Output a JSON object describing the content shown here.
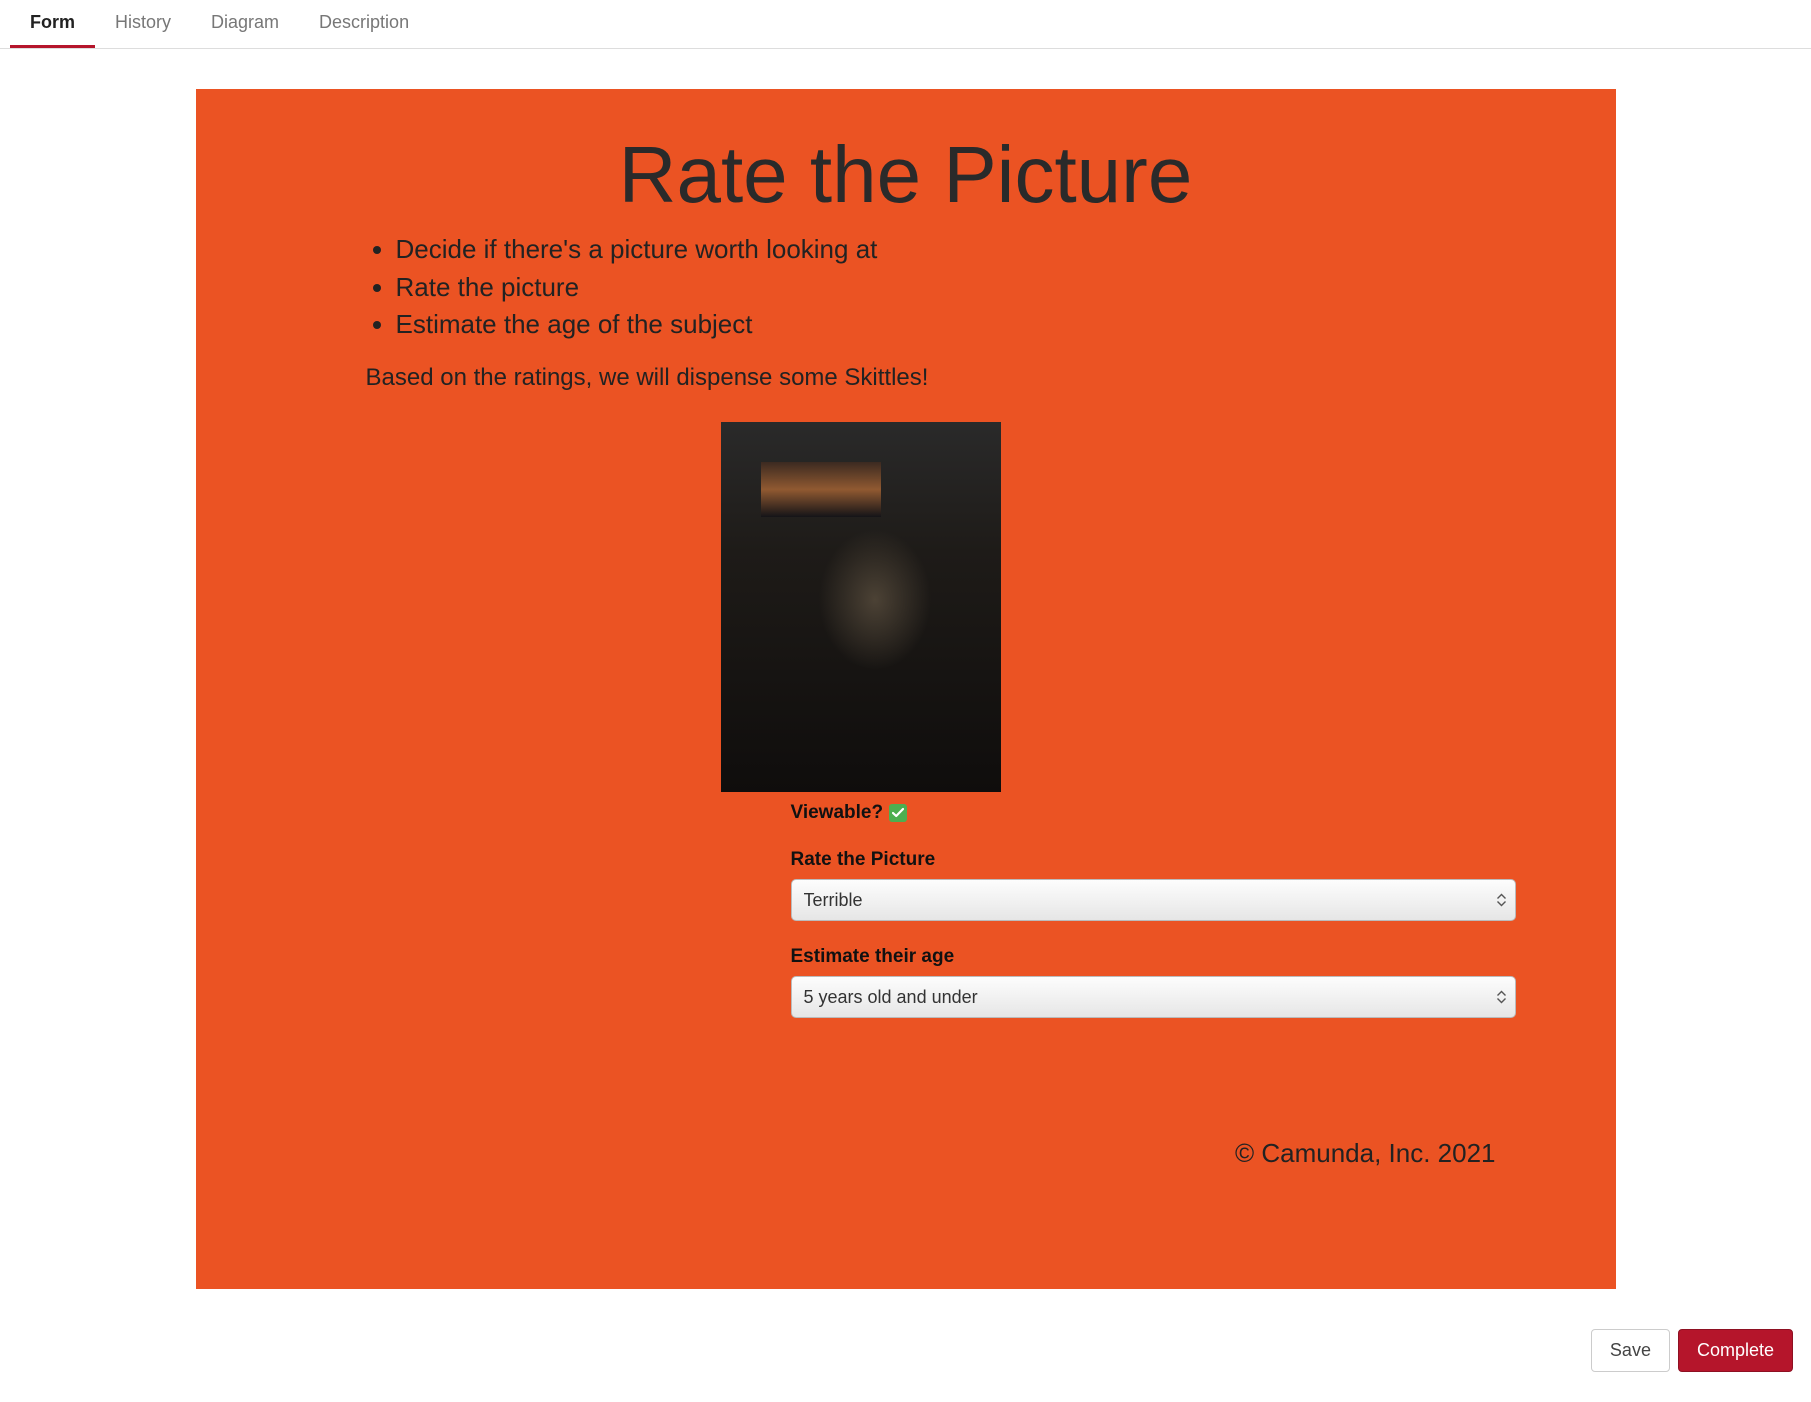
{
  "tabs": {
    "form": "Form",
    "history": "History",
    "diagram": "Diagram",
    "description": "Description"
  },
  "form": {
    "title": "Rate the Picture",
    "instructions": [
      "Decide if there's a picture worth looking at",
      "Rate the picture",
      "Estimate the age of the subject"
    ],
    "sub_text": "Based on the ratings, we will dispense some Skittles!",
    "viewable_label": "Viewable?",
    "viewable_value": true,
    "rate_label": "Rate the Picture",
    "rate_value": "Terrible",
    "age_label": "Estimate their age",
    "age_value": "5 years old and under",
    "copyright": "© Camunda, Inc. 2021"
  },
  "actions": {
    "save": "Save",
    "complete": "Complete"
  }
}
